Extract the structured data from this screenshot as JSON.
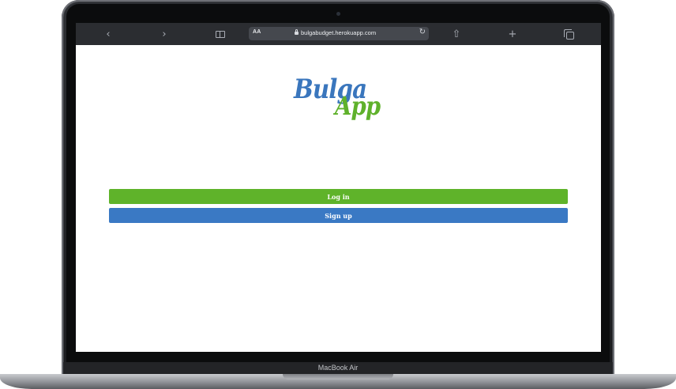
{
  "device": {
    "model_label": "MacBook Air"
  },
  "browser": {
    "reader_label": "AA",
    "url": "bulgabudget.herokuapp.com",
    "icons": {
      "back": "chevron-left-icon",
      "forward": "chevron-right-icon",
      "bookmarks": "book-icon",
      "lock": "lock-icon",
      "reload": "reload-icon",
      "share": "share-icon",
      "new_tab": "plus-icon",
      "tabs": "tabs-icon"
    }
  },
  "page": {
    "logo": {
      "part1": "Bulga",
      "part2": "App",
      "color1": "#3a76bd",
      "color2": "#5fb12b"
    },
    "buttons": {
      "login_label": "Log in",
      "signup_label": "Sign up",
      "login_color": "#5fb32a",
      "signup_color": "#3a79c4"
    }
  }
}
